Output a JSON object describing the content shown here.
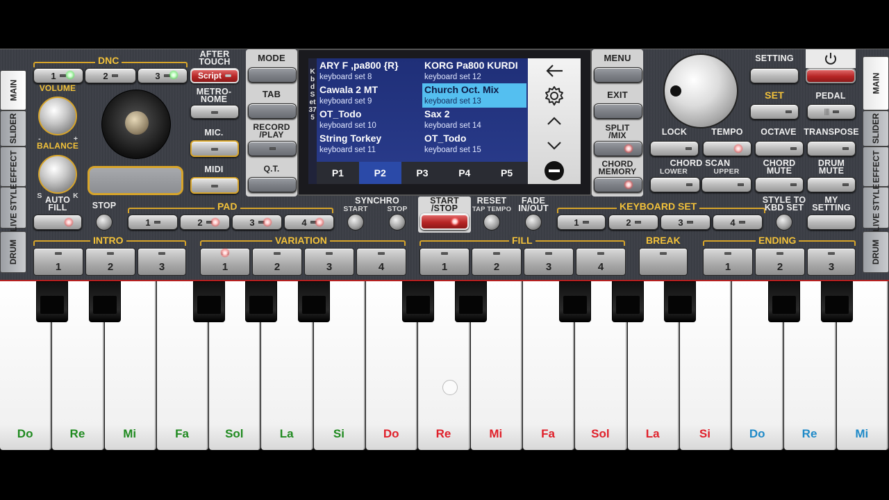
{
  "side_tabs_left": [
    "MAIN",
    "SLIDER",
    "EFFECT",
    "LIVE STYLE",
    "DRUM"
  ],
  "side_tabs_right": [
    "MAIN",
    "SLIDER",
    "EFFECT",
    "LIVE STYLE",
    "DRUM"
  ],
  "dnc": {
    "label": "DNC",
    "buttons": [
      "1",
      "2",
      "3"
    ],
    "after_touch": "AFTER\nTOUCH",
    "script": "Script"
  },
  "volume": "VOLUME",
  "balance": "BALANCE",
  "balance_min": "-",
  "balance_max": "+",
  "balance_s": "S",
  "balance_k": "K",
  "metronome": "METRO-\nNOME",
  "mic": "MIC.",
  "midi": "MIDI",
  "left_menu": {
    "mode": "MODE",
    "tab": "TAB",
    "record_play": "RECORD\n/PLAY",
    "qt": "Q.T."
  },
  "right_menu": {
    "menu": "MENU",
    "exit": "EXIT",
    "split_mix": "SPLIT\n/MIX",
    "chord_memory": "CHORD\nMEMORY"
  },
  "display": {
    "side_text": "Kbd Set 375",
    "slots": [
      {
        "name": "ARY F ,pa800 {R}",
        "sub": "keyboard set 8"
      },
      {
        "name": "KORG Pa800 KURDI",
        "sub": "keyboard set 12"
      },
      {
        "name": "Cawala 2 MT",
        "sub": "keyboard set 9"
      },
      {
        "name": "Church Oct. Mix",
        "sub": "keyboard set 13"
      },
      {
        "name": "OT_Todo",
        "sub": "keyboard set 10"
      },
      {
        "name": "Sax 2",
        "sub": "keyboard set 14"
      },
      {
        "name": "String Torkey",
        "sub": "keyboard set 11"
      },
      {
        "name": "OT_Todo",
        "sub": "keyboard set 15"
      }
    ],
    "pages": [
      "P1",
      "P2",
      "P3",
      "P4",
      "P5"
    ],
    "active_page": "P2"
  },
  "right_top": {
    "setting": "SETTING",
    "set": "SET",
    "pedal": "PEDAL"
  },
  "right_row": {
    "lock": "LOCK",
    "tempo": "TEMPO",
    "octave": "OCTAVE",
    "transpose": "TRANSPOSE"
  },
  "right_row2": {
    "chord_scan": "CHORD SCAN",
    "lower": "LOWER",
    "upper": "UPPER",
    "chord_mute": "CHORD\nMUTE",
    "drum_mute": "DRUM\nMUTE"
  },
  "mid_row": {
    "auto_fill": "AUTO\nFILL",
    "stop": "STOP",
    "pad": "PAD",
    "pad_buttons": [
      "1",
      "2",
      "3",
      "4"
    ],
    "synchro": "SYNCHRO",
    "synchro_start": "START",
    "synchro_stop": "STOP",
    "start_stop": "START\n/STOP",
    "reset": "RESET",
    "tap_tempo": "TAP TEMPO",
    "fade": "FADE\nIN/OUT",
    "keyboard_set": "KEYBOARD SET",
    "kbd_buttons": [
      "1",
      "2",
      "3",
      "4"
    ],
    "style_to_kbd": "STYLE TO\nKBD SET",
    "my_setting": "MY\nSETTING"
  },
  "bottom_row": {
    "intro": "INTRO",
    "intro_buttons": [
      "1",
      "2",
      "3"
    ],
    "variation": "VARIATION",
    "variation_buttons": [
      "1",
      "2",
      "3",
      "4"
    ],
    "fill": "FILL",
    "fill_buttons": [
      "1",
      "2",
      "3",
      "4"
    ],
    "break": "BREAK",
    "ending": "ENDING",
    "ending_buttons": [
      "1",
      "2",
      "3"
    ]
  },
  "keyboard_notes": [
    {
      "n": "Do",
      "c": "#1f8a1f"
    },
    {
      "n": "Re",
      "c": "#1f8a1f"
    },
    {
      "n": "Mi",
      "c": "#1f8a1f"
    },
    {
      "n": "Fa",
      "c": "#1f8a1f"
    },
    {
      "n": "Sol",
      "c": "#1f8a1f"
    },
    {
      "n": "La",
      "c": "#1f8a1f"
    },
    {
      "n": "Si",
      "c": "#1f8a1f"
    },
    {
      "n": "Do",
      "c": "#e0202a"
    },
    {
      "n": "Re",
      "c": "#e0202a"
    },
    {
      "n": "Mi",
      "c": "#e0202a"
    },
    {
      "n": "Fa",
      "c": "#e0202a"
    },
    {
      "n": "Sol",
      "c": "#e0202a"
    },
    {
      "n": "La",
      "c": "#e0202a"
    },
    {
      "n": "Si",
      "c": "#e0202a"
    },
    {
      "n": "Do",
      "c": "#1f8ac8"
    },
    {
      "n": "Re",
      "c": "#1f8ac8"
    },
    {
      "n": "Mi",
      "c": "#1f8ac8"
    }
  ]
}
